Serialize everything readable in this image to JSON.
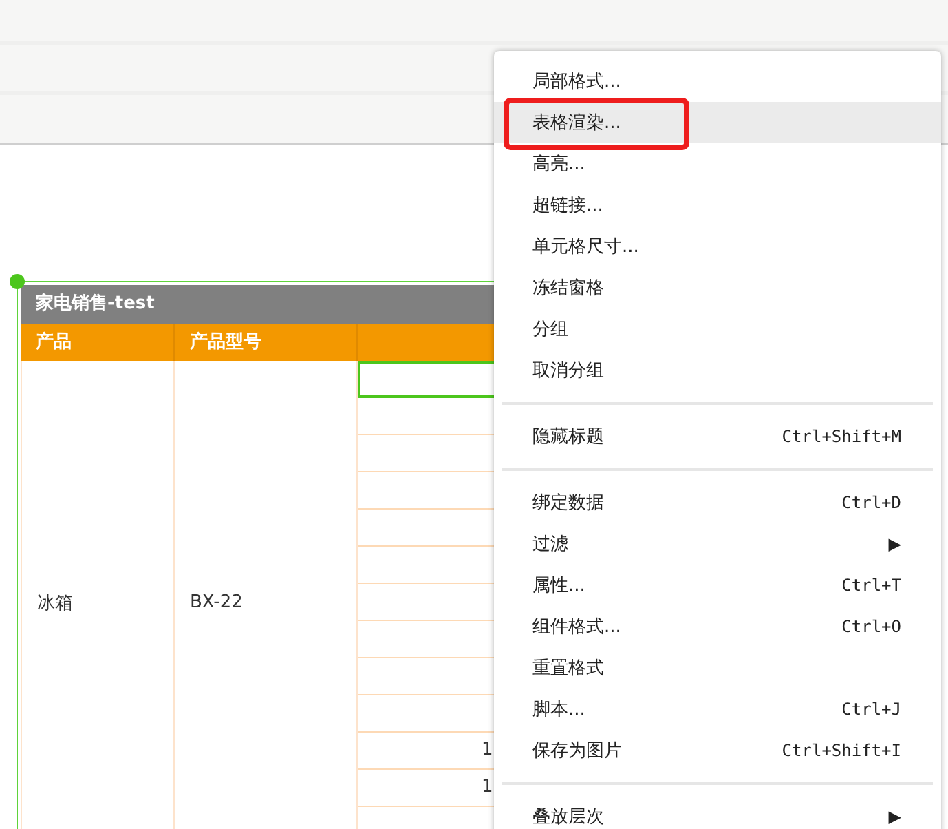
{
  "table": {
    "title": "家电销售-test",
    "columns": [
      "产品",
      "产品型号"
    ],
    "product": "冰箱",
    "model": "BX-22",
    "column_3_cells": [
      {
        "selected": true
      },
      {
        "selected": false
      },
      {
        "selected": false
      },
      {
        "selected": false
      },
      {
        "selected": false
      },
      {
        "selected": false
      },
      {
        "selected": false
      },
      {
        "selected": false
      },
      {
        "selected": false
      },
      {
        "selected": false
      },
      {
        "selected": false,
        "value": "1"
      },
      {
        "selected": false,
        "value": "1"
      },
      {
        "selected": false
      }
    ]
  },
  "context_menu": {
    "groups": [
      [
        {
          "label": "局部格式...",
          "selected": false,
          "annotated": false
        },
        {
          "label": "表格渲染...",
          "selected": true,
          "annotated": true
        },
        {
          "label": "高亮...",
          "selected": false,
          "annotated": false
        },
        {
          "label": "超链接...",
          "selected": false,
          "annotated": false
        },
        {
          "label": "单元格尺寸...",
          "selected": false,
          "annotated": false
        },
        {
          "label": "冻结窗格",
          "selected": false,
          "annotated": false
        },
        {
          "label": "分组",
          "selected": false,
          "annotated": false
        },
        {
          "label": "取消分组",
          "selected": false,
          "annotated": false
        }
      ],
      [
        {
          "label": "隐藏标题",
          "shortcut": "Ctrl+Shift+M",
          "selected": false,
          "annotated": false
        }
      ],
      [
        {
          "label": "绑定数据",
          "shortcut": "Ctrl+D",
          "selected": false,
          "annotated": false
        },
        {
          "label": "过滤",
          "submenu": "▶",
          "selected": false,
          "annotated": false
        },
        {
          "label": "属性...",
          "shortcut": "Ctrl+T",
          "selected": false,
          "annotated": false
        },
        {
          "label": "组件格式...",
          "shortcut": "Ctrl+O",
          "selected": false,
          "annotated": false
        },
        {
          "label": "重置格式",
          "selected": false,
          "annotated": false
        },
        {
          "label": "脚本...",
          "shortcut": "Ctrl+J",
          "selected": false,
          "annotated": false
        },
        {
          "label": "保存为图片",
          "shortcut": "Ctrl+Shift+I",
          "selected": false,
          "annotated": false
        }
      ],
      [
        {
          "label": "叠放层次",
          "submenu": "▶",
          "selected": false,
          "annotated": false
        }
      ]
    ]
  }
}
